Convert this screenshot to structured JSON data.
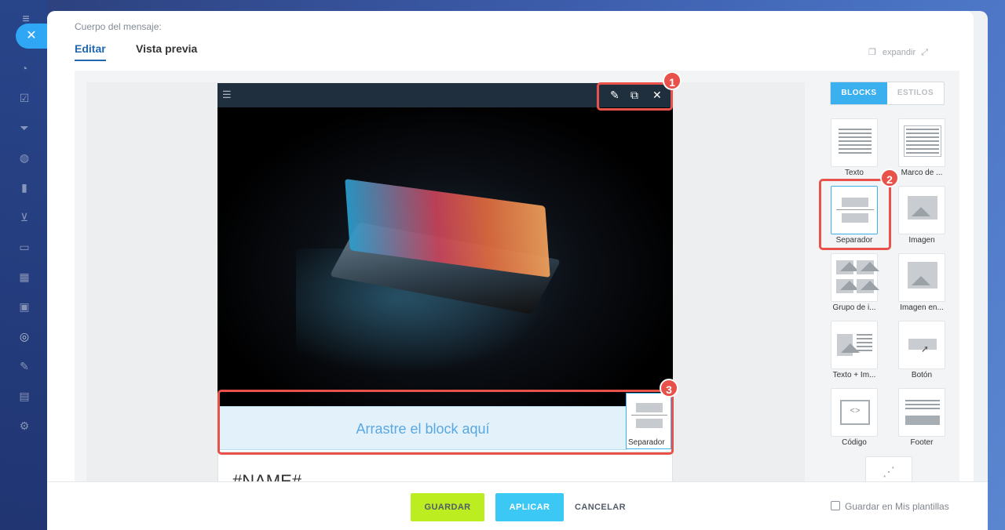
{
  "rail": {
    "close_glyph": "✕"
  },
  "editor": {
    "body_label": "Cuerpo del mensaje:",
    "tabs": [
      {
        "label": "Editar",
        "active": true
      },
      {
        "label": "Vista previa",
        "active": false
      }
    ],
    "expand_label": "expandir"
  },
  "block_toolbar": {
    "menu_icon": "menu-icon",
    "actions": [
      "edit-icon",
      "copy-icon",
      "close-icon"
    ]
  },
  "drop_zone": {
    "text": "Arrastre el block aquí",
    "thumb_label": "Separador"
  },
  "email": {
    "name_placeholder": "#NAME#"
  },
  "palette": {
    "tabs": {
      "blocks": "BLOCKS",
      "styles": "ESTILOS"
    },
    "items": [
      {
        "label": "Texto",
        "icon": "text-block-icon"
      },
      {
        "label": "Marco de ...",
        "icon": "boxed-text-icon"
      },
      {
        "label": "Separador",
        "icon": "divider-icon"
      },
      {
        "label": "Imagen",
        "icon": "image-icon"
      },
      {
        "label": "Grupo de i...",
        "icon": "image-group-icon"
      },
      {
        "label": "Imagen en...",
        "icon": "image-card-icon"
      },
      {
        "label": "Texto + Im...",
        "icon": "text-image-icon"
      },
      {
        "label": "Botón",
        "icon": "button-icon"
      },
      {
        "label": "Código",
        "icon": "code-icon"
      },
      {
        "label": "Footer",
        "icon": "footer-icon"
      }
    ]
  },
  "annotations": [
    "1",
    "2",
    "3"
  ],
  "footer": {
    "save": "GUARDAR",
    "apply": "APLICAR",
    "cancel": "CANCELAR",
    "save_template": "Guardar en Mis plantillas"
  },
  "colors": {
    "accent": "#3bb0ee",
    "save": "#bbed21",
    "apply": "#3bc8f5",
    "annotation": "#e8524a"
  }
}
